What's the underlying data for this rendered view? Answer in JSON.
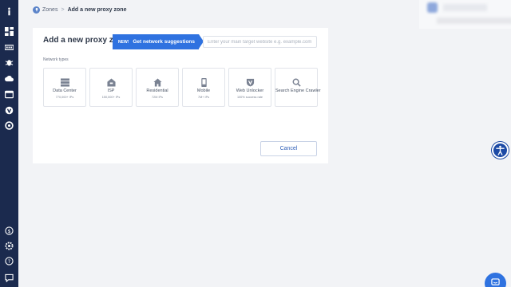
{
  "breadcrumb": {
    "zones_label": "Zones",
    "separator": ">",
    "current": "Add a new proxy zone"
  },
  "rail": {
    "icons": [
      "info-icon",
      "dashboard-icon",
      "network-icon",
      "bug-icon",
      "cloud-icon",
      "browser-icon",
      "unlocker-icon",
      "support-icon",
      "billing-icon",
      "settings-icon",
      "help-icon",
      "messages-icon"
    ]
  },
  "card": {
    "title": "Add a new proxy zone",
    "new_badge": "NEW!",
    "suggest_label": "Get network suggestions",
    "target_placeholder": "Enter your main target website e.g. example.com",
    "target_value": "",
    "network_types_label": "Network types",
    "types": [
      {
        "name": "Data Center",
        "sub": "770,000+ IPs",
        "icon": "server-icon"
      },
      {
        "name": "ISP",
        "sub": "150,000+ IPs",
        "icon": "isp-building-icon"
      },
      {
        "name": "Residential",
        "sub": "72M IPs",
        "icon": "house-icon"
      },
      {
        "name": "Mobile",
        "sub": "7M+ IPs",
        "icon": "mobile-icon"
      },
      {
        "name": "Web Unlocker",
        "sub": "100% success rate",
        "icon": "unlocker-shield-icon"
      },
      {
        "name": "Search Engine Crawler",
        "sub": "",
        "icon": "magnifier-icon"
      }
    ],
    "cancel_label": "Cancel"
  },
  "colors": {
    "rail": "#1b2a4e",
    "accent": "#2f72e0",
    "background": "#f2f3f6"
  }
}
